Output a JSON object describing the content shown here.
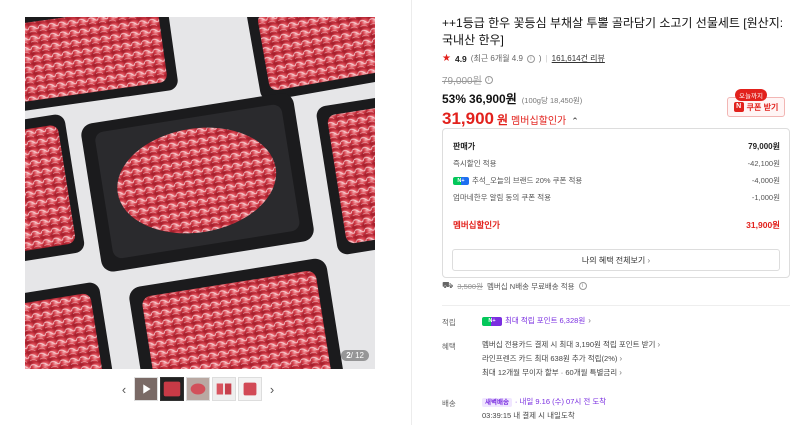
{
  "gallery": {
    "page_current": "2",
    "page_total": "/ 12",
    "prev_arrow": "‹",
    "next_arrow": "›"
  },
  "product": {
    "title": "++1등급 한우 꽃등심 부채살 투뿔 골라담기 소고기 선물세트 [원산지:국내산 한우]",
    "rating": "4.9",
    "rating_detail": "(최근 6개월 4.9",
    "review_count": "161,614건 리뷰",
    "original_price": "79,000원",
    "discount_rate": "53%",
    "sale_price": "36,900원",
    "unit_price": "(100g당 18,450원)",
    "member_price": "31,900",
    "member_unit": "원",
    "member_label": "멤버십할인가",
    "coupon_today": "오늘까지",
    "coupon_label": "쿠폰 받기"
  },
  "breakdown": {
    "rows": [
      {
        "label": "판매가",
        "value": "79,000원"
      },
      {
        "label": "즉시할인 적용",
        "value": "-42,100원"
      },
      {
        "label": "추석_오늘의 브랜드 20% 쿠폰 적용",
        "value": "-4,000원"
      },
      {
        "label": "엄마네한우 알림 동의 쿠폰 적용",
        "value": "-1,000원"
      }
    ],
    "total_label": "멤버십할인가",
    "total_value": "31,900원",
    "benefit_button": "나의 혜택 전체보기",
    "npay_badge": "N+"
  },
  "shipping": {
    "fee": "3,500원",
    "free_text": "멤버십 N배송 무료배송 적용"
  },
  "points": {
    "label": "적립",
    "badge": "N+",
    "text": "최대 적립 포인트 6,328원"
  },
  "benefits": {
    "label": "혜택",
    "lines": [
      "멤버십 전용카드 결제 시 최대 3,190원 적립 포인트 받기",
      "라인프렌즈 카드 최대 638원 추가 적립(2%)",
      "최대 12개월 무이자 할부 · 60개월 특별금리"
    ]
  },
  "delivery": {
    "label": "배송",
    "badge": "새벽배송",
    "text": "· 내일 9.16 (수) 07시 전 도착",
    "line2": "03:39:15  내 결제 시 내일도착"
  },
  "colors": {
    "accent_red": "#e2211c",
    "naver_green": "#03c75a",
    "purple": "#7a2ee0"
  }
}
